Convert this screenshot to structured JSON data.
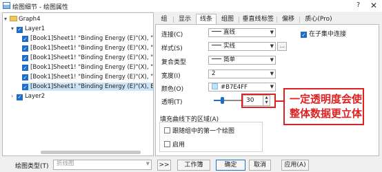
{
  "window": {
    "title": "绘图细节 - 绘图属性",
    "help_glyph": "?",
    "close_glyph": "✕"
  },
  "tree": {
    "graph": "Graph4",
    "layer1": "Layer1",
    "layer2": "Layer2",
    "plots": [
      "[Book1]Sheet1! \"Binding Energy (E)\"(X), \"",
      "[Book1]Sheet1! \"Binding Energy (E)\"(X), \"",
      "[Book1]Sheet1! \"Binding Energy (E)\"(X), \"",
      "[Book1]Sheet1! \"Binding Energy (E)\"(X), \"",
      "[Book1]Sheet1! \"Binding Energy (E)\"(X), \"",
      "[Book1]Sheet1! \"Binding Energy (E)\"(X), E"
    ],
    "selected_index": 5
  },
  "tabs": [
    "组",
    "显示",
    "线条",
    "组图",
    "垂直线",
    "标签",
    "偏移",
    "质心(Pro)"
  ],
  "active_tab": "线条",
  "form": {
    "connect_label": "连接(C)",
    "connect_value": "直线",
    "connect_in_set_label": "在子集中连接",
    "style_label": "样式(S)",
    "style_value": "实线",
    "dots_label": "...",
    "compound_label": "复合类型",
    "compound_value": "简单",
    "width_label": "宽度(I)",
    "width_value": "2",
    "color_label": "颜色(O)",
    "color_value": "#B7E4FF",
    "transparency_label": "透明(T)",
    "transparency_value": "30",
    "fill_group_label": "填充曲线下的区域(A)",
    "follow_first_label": "跟随组中的第一个绘图",
    "enable_label": "启用"
  },
  "annotation": {
    "line1": "一定透明度会使",
    "line2": "整体数据更立体"
  },
  "bottom": {
    "plot_type_label": "绘图类型(T)",
    "plot_type_value": "折线图",
    "forward_button": ">>",
    "workbook_button": "工作簿",
    "ok_button": "确定",
    "cancel_button": "取消",
    "apply_button": "应用(A)"
  },
  "colors": {
    "accent": "#1f6ec6",
    "annotation_red": "#e02020",
    "line_color": "#B7E4FF",
    "selected_row": "#cce4f7"
  }
}
